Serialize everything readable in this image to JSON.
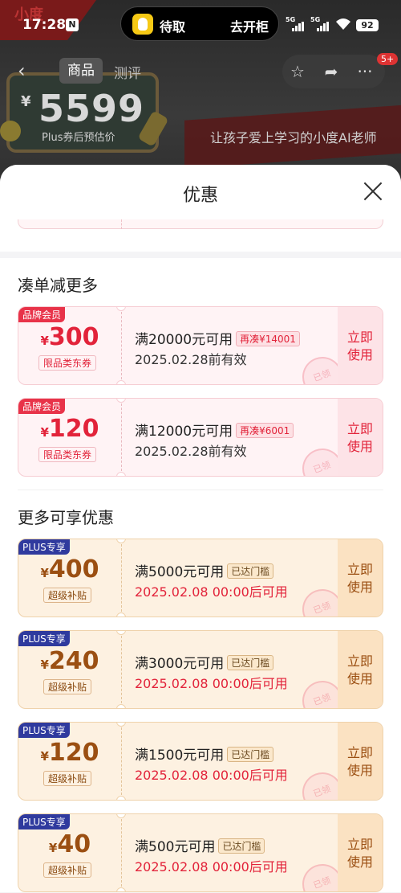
{
  "status_bar": {
    "time": "17:28",
    "notification": "N",
    "pill_left": "待取",
    "pill_right": "去开柜",
    "signal_1": "5G",
    "signal_2": "5G",
    "battery": "92"
  },
  "background_page": {
    "brand": "小度",
    "tabs": [
      {
        "label": "商品"
      },
      {
        "label": "测评"
      }
    ],
    "badge": "5+",
    "price_yen": "¥",
    "price": "5599",
    "price_note": "Plus券后预估价",
    "slogan": "让孩子爱上学习的小度AI老师"
  },
  "sheet": {
    "title": "优惠"
  },
  "sections": [
    {
      "title": "凑单减更多",
      "coupons": [
        {
          "tag": "品牌会员",
          "yen": "¥",
          "amount": "300",
          "sub": "限品类东券",
          "condition": "满20000元可用",
          "tip": "再凑¥14001",
          "valid": "2025.02.28前有效",
          "button": "立即使用",
          "stamp": "已领"
        },
        {
          "tag": "品牌会员",
          "yen": "¥",
          "amount": "120",
          "sub": "限品类东券",
          "condition": "满12000元可用",
          "tip": "再凑¥6001",
          "valid": "2025.02.28前有效",
          "button": "立即使用",
          "stamp": "已领"
        }
      ]
    },
    {
      "title": "更多可享优惠",
      "coupons": [
        {
          "tag": "PLUS专享",
          "yen": "¥",
          "amount": "400",
          "sub": "超级补贴",
          "condition": "满5000元可用",
          "tip": "已达门槛",
          "valid": "2025.02.08 00:00后可用",
          "button": "立即使用",
          "stamp": "已领"
        },
        {
          "tag": "PLUS专享",
          "yen": "¥",
          "amount": "240",
          "sub": "超级补贴",
          "condition": "满3000元可用",
          "tip": "已达门槛",
          "valid": "2025.02.08 00:00后可用",
          "button": "立即使用",
          "stamp": "已领"
        },
        {
          "tag": "PLUS专享",
          "yen": "¥",
          "amount": "120",
          "sub": "超级补贴",
          "condition": "满1500元可用",
          "tip": "已达门槛",
          "valid": "2025.02.08 00:00后可用",
          "button": "立即使用",
          "stamp": "已领"
        },
        {
          "tag": "PLUS专享",
          "yen": "¥",
          "amount": "40",
          "sub": "超级补贴",
          "condition": "满500元可用",
          "tip": "已达门槛",
          "valid": "2025.02.08 00:00后可用",
          "button": "立即使用",
          "stamp": "已领"
        }
      ]
    }
  ]
}
